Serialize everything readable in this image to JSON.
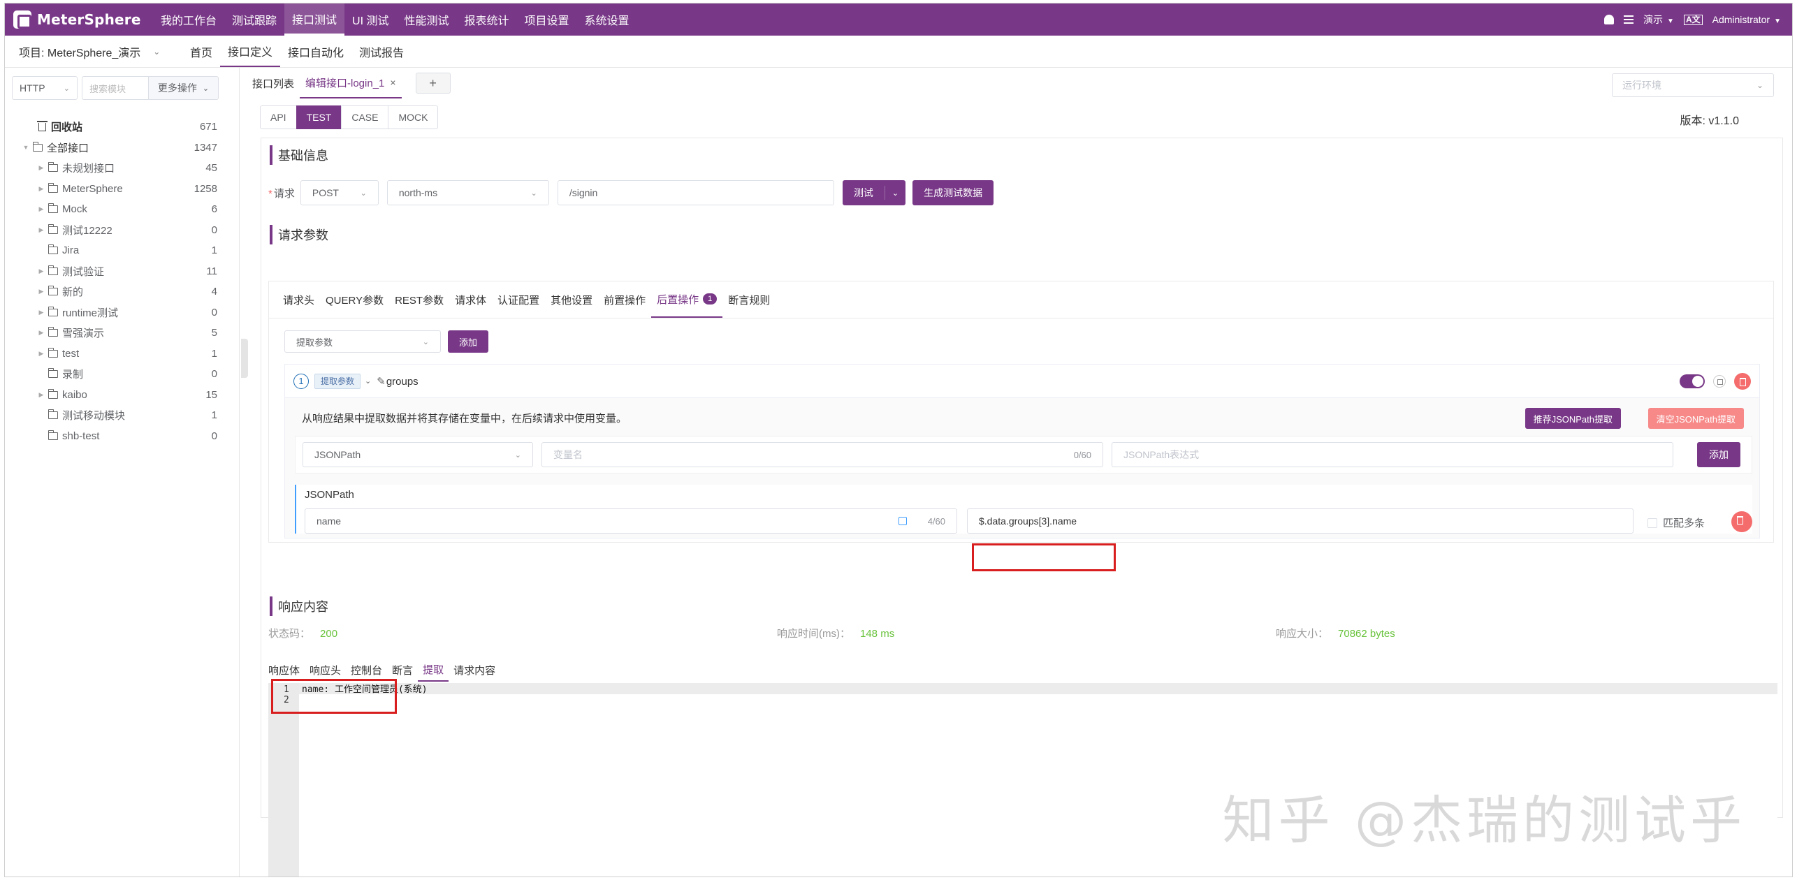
{
  "app": {
    "logo_text": "MeterSphere"
  },
  "topnav": {
    "items": [
      "我的工作台",
      "测试跟踪",
      "接口测试",
      "UI 测试",
      "性能测试",
      "报表统计",
      "项目设置",
      "系统设置"
    ],
    "active": "接口测试",
    "workspace": "演示",
    "language_label": "A文",
    "user": "Administrator"
  },
  "subnav": {
    "project_label": "项目: MeterSphere_演示",
    "items": [
      "首页",
      "接口定义",
      "接口自动化",
      "测试报告"
    ],
    "active": "接口定义"
  },
  "sidebar": {
    "protocol": "HTTP",
    "search_placeholder": "搜索模块",
    "more_ops": "更多操作",
    "tree": [
      {
        "label": "回收站",
        "count": "671",
        "icon": "trash-icon",
        "level": 0
      },
      {
        "label": "全部接口",
        "count": "1347",
        "icon": "folder-icon",
        "level": 0,
        "expanded": true
      },
      {
        "label": "未规划接口",
        "count": "45",
        "icon": "folder-icon",
        "level": 1,
        "has_children": true
      },
      {
        "label": "MeterSphere",
        "count": "1258",
        "icon": "folder-icon",
        "level": 1,
        "has_children": true
      },
      {
        "label": "Mock",
        "count": "6",
        "icon": "folder-icon",
        "level": 1,
        "has_children": true
      },
      {
        "label": "测试12222",
        "count": "0",
        "icon": "folder-icon",
        "level": 1,
        "has_children": true
      },
      {
        "label": "Jira",
        "count": "1",
        "icon": "folder-icon",
        "level": 1,
        "has_children": false
      },
      {
        "label": "测试验证",
        "count": "11",
        "icon": "folder-icon",
        "level": 1,
        "has_children": true
      },
      {
        "label": "新的",
        "count": "4",
        "icon": "folder-icon",
        "level": 1,
        "has_children": true
      },
      {
        "label": "runtime测试",
        "count": "0",
        "icon": "folder-icon",
        "level": 1,
        "has_children": true
      },
      {
        "label": "雪强演示",
        "count": "5",
        "icon": "folder-icon",
        "level": 1,
        "has_children": true
      },
      {
        "label": "test",
        "count": "1",
        "icon": "folder-icon",
        "level": 1,
        "has_children": true
      },
      {
        "label": "录制",
        "count": "0",
        "icon": "folder-icon",
        "level": 1,
        "has_children": false
      },
      {
        "label": "kaibo",
        "count": "15",
        "icon": "folder-icon",
        "level": 1,
        "has_children": true
      },
      {
        "label": "测试移动模块",
        "count": "1",
        "icon": "folder-icon",
        "level": 1,
        "has_children": false
      },
      {
        "label": "shb-test",
        "count": "0",
        "icon": "folder-icon",
        "level": 1,
        "has_children": false
      }
    ]
  },
  "tabs": {
    "list_label": "接口列表",
    "edit_label": "编辑接口-login_1",
    "add_label": "+",
    "env_placeholder": "运行环境"
  },
  "mode": {
    "buttons": [
      "API",
      "TEST",
      "CASE",
      "MOCK"
    ],
    "active": "TEST",
    "version": "版本: v1.1.0"
  },
  "basic": {
    "title": "基础信息",
    "request_label": "请求",
    "method": "POST",
    "env": "north-ms",
    "path": "/signin",
    "test_button": "测试",
    "generate_button": "生成测试数据"
  },
  "params": {
    "title": "请求参数",
    "tabs": [
      "请求头",
      "QUERY参数",
      "REST参数",
      "请求体",
      "认证配置",
      "其他设置",
      "前置操作",
      "后置操作",
      "断言规则"
    ],
    "active": "后置操作",
    "badge": "1",
    "add_select": "提取参数",
    "add_button": "添加"
  },
  "extract": {
    "index": "1",
    "tag": "提取参数",
    "name": "groups",
    "description": "从响应结果中提取数据并将其存储在变量中，在后续请求中使用变量。",
    "recommend_button": "推荐JSONPath提取",
    "clear_button": "清空JSONPath提取",
    "type": "JSONPath",
    "var_placeholder": "变量名",
    "var_count": "0/60",
    "expr_placeholder": "JSONPath表达式",
    "add_button": "添加",
    "section_label": "JSONPath",
    "row_name": "name",
    "row_count": "4/60",
    "row_expr": "$.data.groups[3].name",
    "match_multi": "匹配多条"
  },
  "response": {
    "title": "响应内容",
    "status_label": "状态码：",
    "status": "200",
    "time_label": "响应时间(ms)：",
    "time": "148 ms",
    "size_label": "响应大小：",
    "size": "70862 bytes",
    "tabs": [
      "响应体",
      "响应头",
      "控制台",
      "断言",
      "提取",
      "请求内容"
    ],
    "active": "提取",
    "lines": [
      "1",
      "2"
    ],
    "code": "name: 工作空间管理员(系统)"
  },
  "watermark": "知乎 @杰瑞的测试乎",
  "colors": {
    "brand": "#783887",
    "success": "#67c23a",
    "danger": "#f56c6c",
    "highlight": "#d81e1e"
  }
}
